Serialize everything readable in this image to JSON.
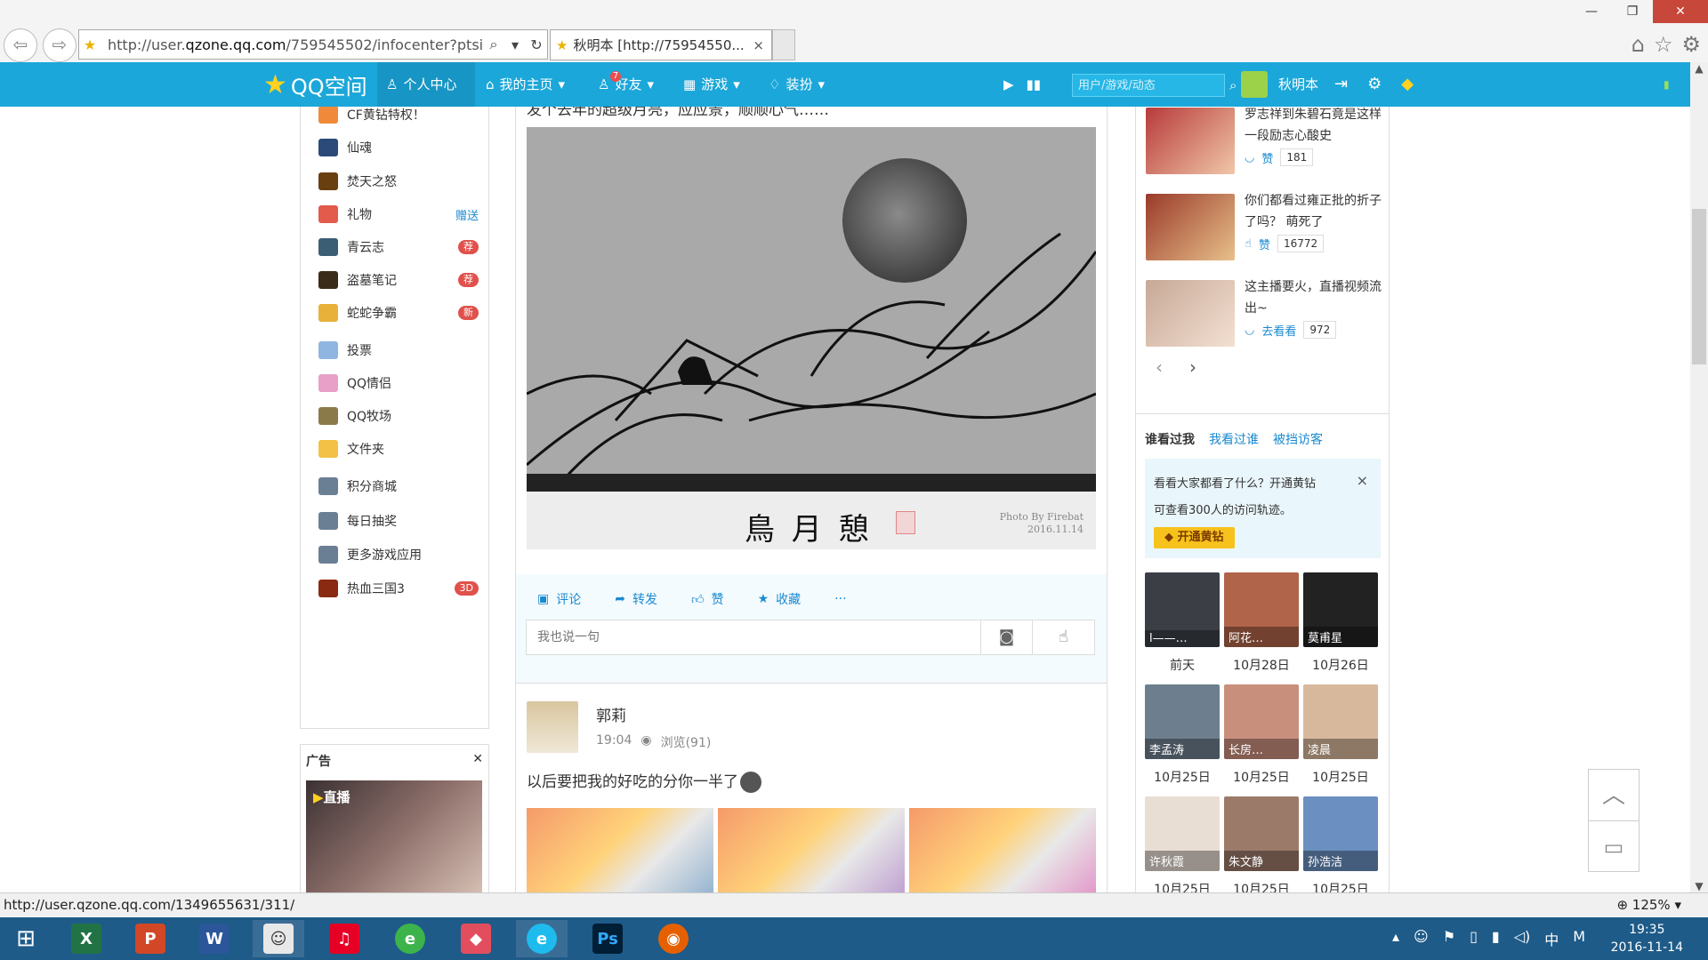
{
  "window": {
    "minimize": "—",
    "maximize": "❐",
    "close": "✕"
  },
  "browser": {
    "url_prefix": "http://user.",
    "url_domain": "qzone.qq.com",
    "url_suffix": "/759545502/infocenter?ptsig=l",
    "tab_title": "秋明本 [http://75954550...",
    "tab_close": "×"
  },
  "qzone": {
    "logo": "QQ空间",
    "nav": {
      "center": "个人中心",
      "home": "我的主页",
      "friends": "好友",
      "friends_badge": "7",
      "games": "游戏",
      "decorate": "装扮"
    },
    "search_placeholder": "用户/游戏/动态",
    "username": "秋明本"
  },
  "left_menu": [
    {
      "label": "CF黄钻特权！",
      "color": "#f08a3a"
    },
    {
      "label": "仙魂",
      "color": "#2b4a7a"
    },
    {
      "label": "焚天之怒",
      "color": "#6a3f10"
    },
    {
      "label": "礼物",
      "color": "#e25b4b",
      "extra": "赠送"
    },
    {
      "label": "青云志",
      "color": "#3c5e75",
      "tag": "荐"
    },
    {
      "label": "盗墓笔记",
      "color": "#3a2a18",
      "tag": "荐"
    },
    {
      "label": "蛇蛇争霸",
      "color": "#e7b13a",
      "tag": "新"
    },
    {
      "label": "投票",
      "color": "#8fb6e0"
    },
    {
      "label": "QQ情侣",
      "color": "#e8a0c8"
    },
    {
      "label": "QQ牧场",
      "color": "#8a7a4a"
    },
    {
      "label": "文件夹",
      "color": "#f3c146"
    },
    {
      "label": "积分商城",
      "color": "#6b7f94"
    },
    {
      "label": "每日抽奖",
      "color": "#6b7f94"
    },
    {
      "label": "更多游戏应用",
      "color": "#6b7f94"
    },
    {
      "label": "热血三国3",
      "color": "#8a2a10",
      "tag": "3D"
    }
  ],
  "ad": {
    "title": "广告",
    "close": "✕",
    "live": "直播"
  },
  "post1": {
    "text": "发个去年的超级月亮，应应景，顺顺心气……",
    "photo_caption": "鳥 月 憩",
    "photo_credit": "Photo By Firebat",
    "photo_date": "2016.11.14",
    "actions": {
      "comment": "评论",
      "share": "转发",
      "like": "赞",
      "fav": "收藏",
      "more": "···"
    },
    "comment_placeholder": "我也说一句"
  },
  "post2": {
    "author": "郭莉",
    "time": "19:04",
    "views": "浏览(91)",
    "text": "以后要把我的好吃的分你一半了"
  },
  "videos": [
    {
      "title": "罗志祥到朱碧石竟是这样一段励志心酸史",
      "action": "赞",
      "count": "181"
    },
    {
      "title": "你们都看过雍正批的折子了吗？ 萌死了",
      "action": "赞",
      "count": "16772"
    },
    {
      "title": "这主播要火，直播视频流出~",
      "action": "去看看",
      "count": "972"
    }
  ],
  "visitors": {
    "tabs": [
      "谁看过我",
      "我看过谁",
      "被挡访客"
    ],
    "notice_line1": "看看大家都看了什么？开通黄钻",
    "notice_line2": "可查看300人的访问轨迹。",
    "notice_btn": "开通黄钻",
    "notice_close": "×",
    "list": [
      {
        "name": "l——…",
        "date": "前天",
        "color": "#3b3f45"
      },
      {
        "name": "阿花…",
        "date": "10月28日",
        "color": "#b0644a"
      },
      {
        "name": "莫甫星",
        "date": "10月26日",
        "color": "#222222"
      },
      {
        "name": "李孟涛",
        "date": "10月25日",
        "color": "#6d7f8e"
      },
      {
        "name": "长房…",
        "date": "10月25日",
        "color": "#c98f7d"
      },
      {
        "name": "凌晨",
        "date": "10月25日",
        "color": "#d8b89c"
      },
      {
        "name": "许秋霞",
        "date": "10月25日",
        "color": "#e9ded4"
      },
      {
        "name": "朱文静",
        "date": "10月25日",
        "color": "#9c7a6a"
      },
      {
        "name": "孙浩洁",
        "date": "10月25日",
        "color": "#6a8fc0"
      }
    ]
  },
  "status_url": "http://user.qzone.qq.com/1349655631/311/",
  "zoom": "125%",
  "taskbar": {
    "time": "19:35",
    "date": "2016-11-14",
    "ime": "中",
    "ime2": "M"
  }
}
